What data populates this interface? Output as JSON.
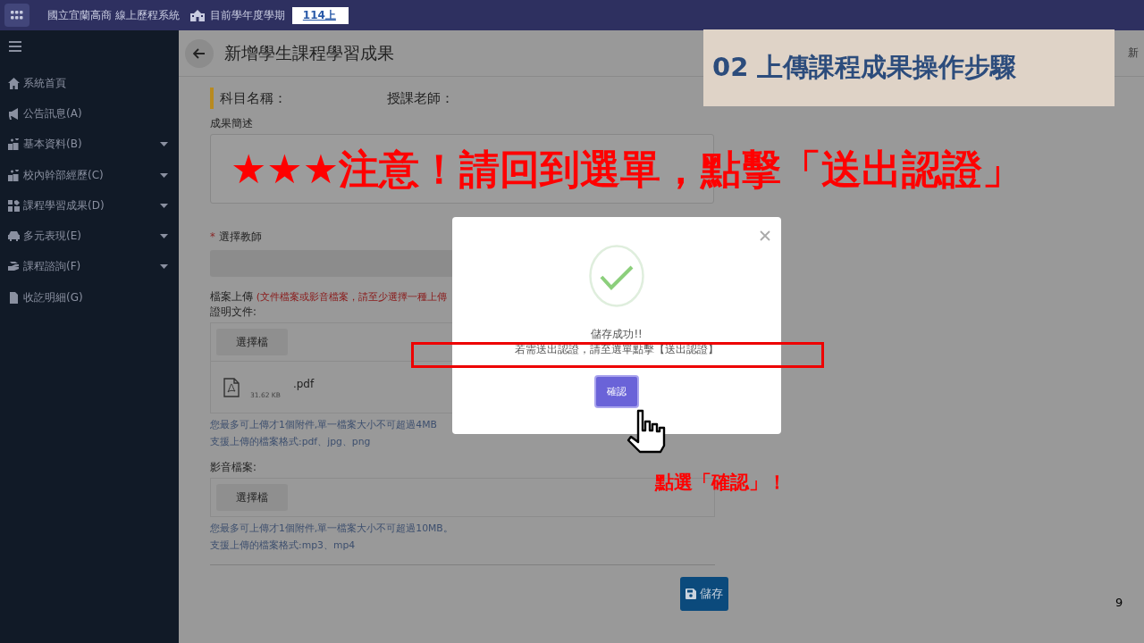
{
  "topbar": {
    "school": "國立宜蘭高商 線上歷程系統",
    "term_label": "目前學年度學期",
    "term_value": "114上"
  },
  "sidebar": {
    "items": [
      {
        "label": "系統首頁",
        "kind": "home",
        "expandable": false
      },
      {
        "label": "公告訊息(A)",
        "kind": "megaphone",
        "expandable": false
      },
      {
        "label": "基本資料(B)",
        "kind": "people",
        "expandable": true
      },
      {
        "label": "校內幹部經歷(C)",
        "kind": "people",
        "expandable": true
      },
      {
        "label": "課程學習成果(D)",
        "kind": "puzzle",
        "expandable": true
      },
      {
        "label": "多元表現(E)",
        "kind": "car",
        "expandable": true
      },
      {
        "label": "課程諮詢(F)",
        "kind": "hand",
        "expandable": true
      },
      {
        "label": "收訖明細(G)",
        "kind": "file",
        "expandable": false
      }
    ]
  },
  "page": {
    "title": "新增學生課程學習成果",
    "breadcrumb": "新",
    "subject_label": "科目名稱：",
    "teacher_label": "授課老師：",
    "description_label": "成果簡述",
    "teacher_select_label": "選擇教師",
    "required_mark": "*",
    "upload_label": "檔案上傳",
    "upload_note": "(文件檔案或影音檔案，請至少選擇一種上傳",
    "doc_section": {
      "label": "證明文件:",
      "button": "選擇檔",
      "file": {
        "name": ".pdf",
        "size": "31.62 KB"
      },
      "hints": [
        "您最多可上傳才1個附件,單一檔案大小不可超過4MB",
        "支援上傳的檔案格式:pdf、jpg、png"
      ]
    },
    "media_section": {
      "label": "影音檔案:",
      "button": "選擇檔",
      "hints": [
        "您最多可上傳才1個附件,單一檔案大小不可超過10MB。",
        "支援上傳的檔案格式:mp3、mp4"
      ]
    },
    "save_button": "儲存"
  },
  "modal": {
    "title": "儲存成功!!",
    "message": "若需送出認證，請至選單點擊【送出認證】",
    "confirm": "確認"
  },
  "annotations": {
    "slide_title": "02 上傳課程成果操作步驟",
    "notice": "★★★注意！請回到選單，點擊「送出認證」",
    "click_hint": "點選「確認」！",
    "page_number": "9"
  }
}
